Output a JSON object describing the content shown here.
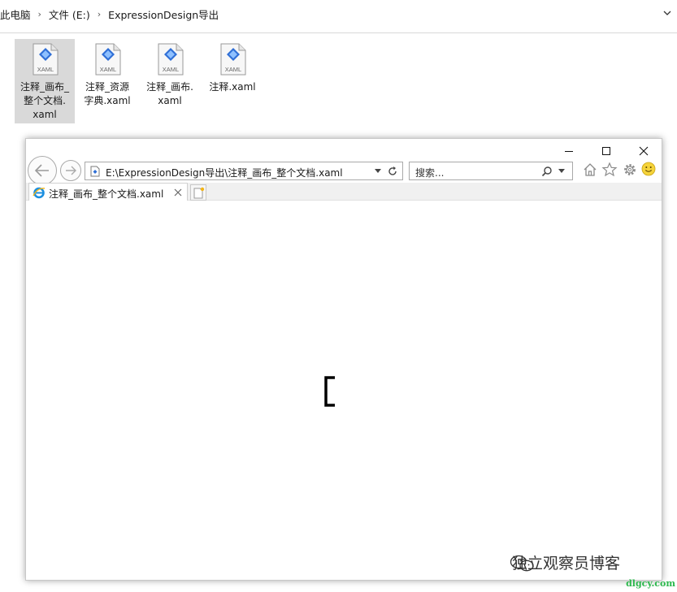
{
  "explorer": {
    "breadcrumbs": [
      "此电脑",
      "文件 (E:)",
      "ExpressionDesign导出"
    ],
    "files": [
      {
        "name": "注释_画布_\n整个文档.\nxaml",
        "icon": "xaml-file-icon",
        "selected": true,
        "badge": "XAML"
      },
      {
        "name": "注释_资源\n字典.xaml",
        "icon": "xaml-file-icon",
        "selected": false,
        "badge": "XAML"
      },
      {
        "name": "注释_画布.\nxaml",
        "icon": "xaml-file-icon",
        "selected": false,
        "badge": "XAML"
      },
      {
        "name": "注释.xaml",
        "icon": "xaml-file-icon",
        "selected": false,
        "badge": "XAML"
      }
    ]
  },
  "browser": {
    "address": "E:\\ExpressionDesign导出\\注释_画布_整个文档.xaml",
    "search_placeholder": "搜索...",
    "tab_title": "注释_画布_整个文档.xaml",
    "content_glyph": "["
  },
  "watermark": "独立观察员博客",
  "site": "dlgcy.com"
}
